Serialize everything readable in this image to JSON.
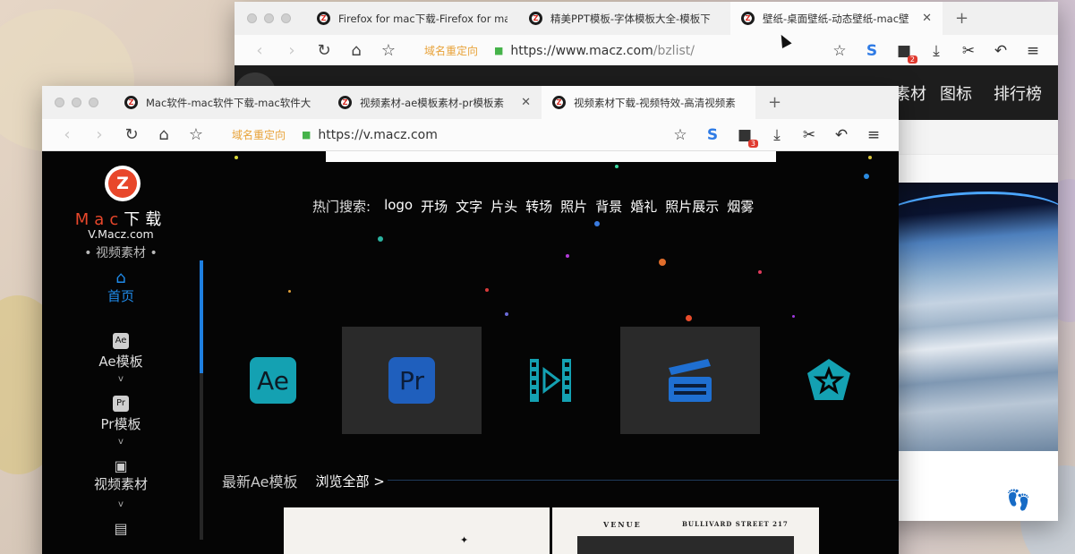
{
  "back_window": {
    "tabs": [
      {
        "title": "Firefox for mac下载-Firefox for mac"
      },
      {
        "title": "精美PPT模板-字体模板大全-模板下"
      },
      {
        "title": "壁纸-桌面壁纸-动态壁纸-mac壁"
      }
    ],
    "redirect_label": "域名重定向",
    "url_host": "https://www.macz.com",
    "url_path": "/bzlist/",
    "badge_count": "2",
    "site_nav": [
      "素材",
      "图标",
      "排行榜"
    ]
  },
  "front_window": {
    "tabs": [
      {
        "title": "Mac软件-mac软件下载-mac软件大"
      },
      {
        "title": "视频素材-ae模板素材-pr模板素"
      },
      {
        "title": "视频素材下载-视频特效-高清视频素"
      }
    ],
    "redirect_label": "域名重定向",
    "url": "https://v.macz.com",
    "badge_count": "3"
  },
  "site": {
    "logo_letter": "Z",
    "brand_mac": "Mac",
    "brand_download": "下载",
    "domain": "V.Macz.com",
    "category": "• 视频素材 •",
    "menu": [
      {
        "label": "首页",
        "icon": "home-icon"
      },
      {
        "label": "Ae模板",
        "icon": "ae-icon",
        "icon_text": "Ae"
      },
      {
        "label": "Pr模板",
        "icon": "pr-icon",
        "icon_text": "Pr"
      },
      {
        "label": "视频素材",
        "icon": "film-icon"
      },
      {
        "label": "",
        "icon": "clapper-icon"
      }
    ],
    "hot_search_label": "热门搜索:",
    "hot_search_terms": [
      "logo",
      "开场",
      "文字",
      "片头",
      "转场",
      "照片",
      "背景",
      "婚礼",
      "照片展示",
      "烟雾"
    ],
    "categories": [
      {
        "icon": "ae-icon",
        "text": "Ae"
      },
      {
        "icon": "pr-icon",
        "text": "Pr"
      },
      {
        "icon": "video-material-icon"
      },
      {
        "icon": "clapperboard-icon"
      },
      {
        "icon": "star-badge-icon"
      }
    ],
    "section_title": "最新Ae模板",
    "section_link": "浏览全部 >",
    "thumb_venue": "VENUE",
    "thumb_street": "BULLIVARD STREET 217"
  },
  "colors": {
    "accent_blue": "#1f8bea",
    "brand_red": "#e8472b",
    "ae_teal": "#14a1b2",
    "pr_blue": "#1f5fbd"
  }
}
